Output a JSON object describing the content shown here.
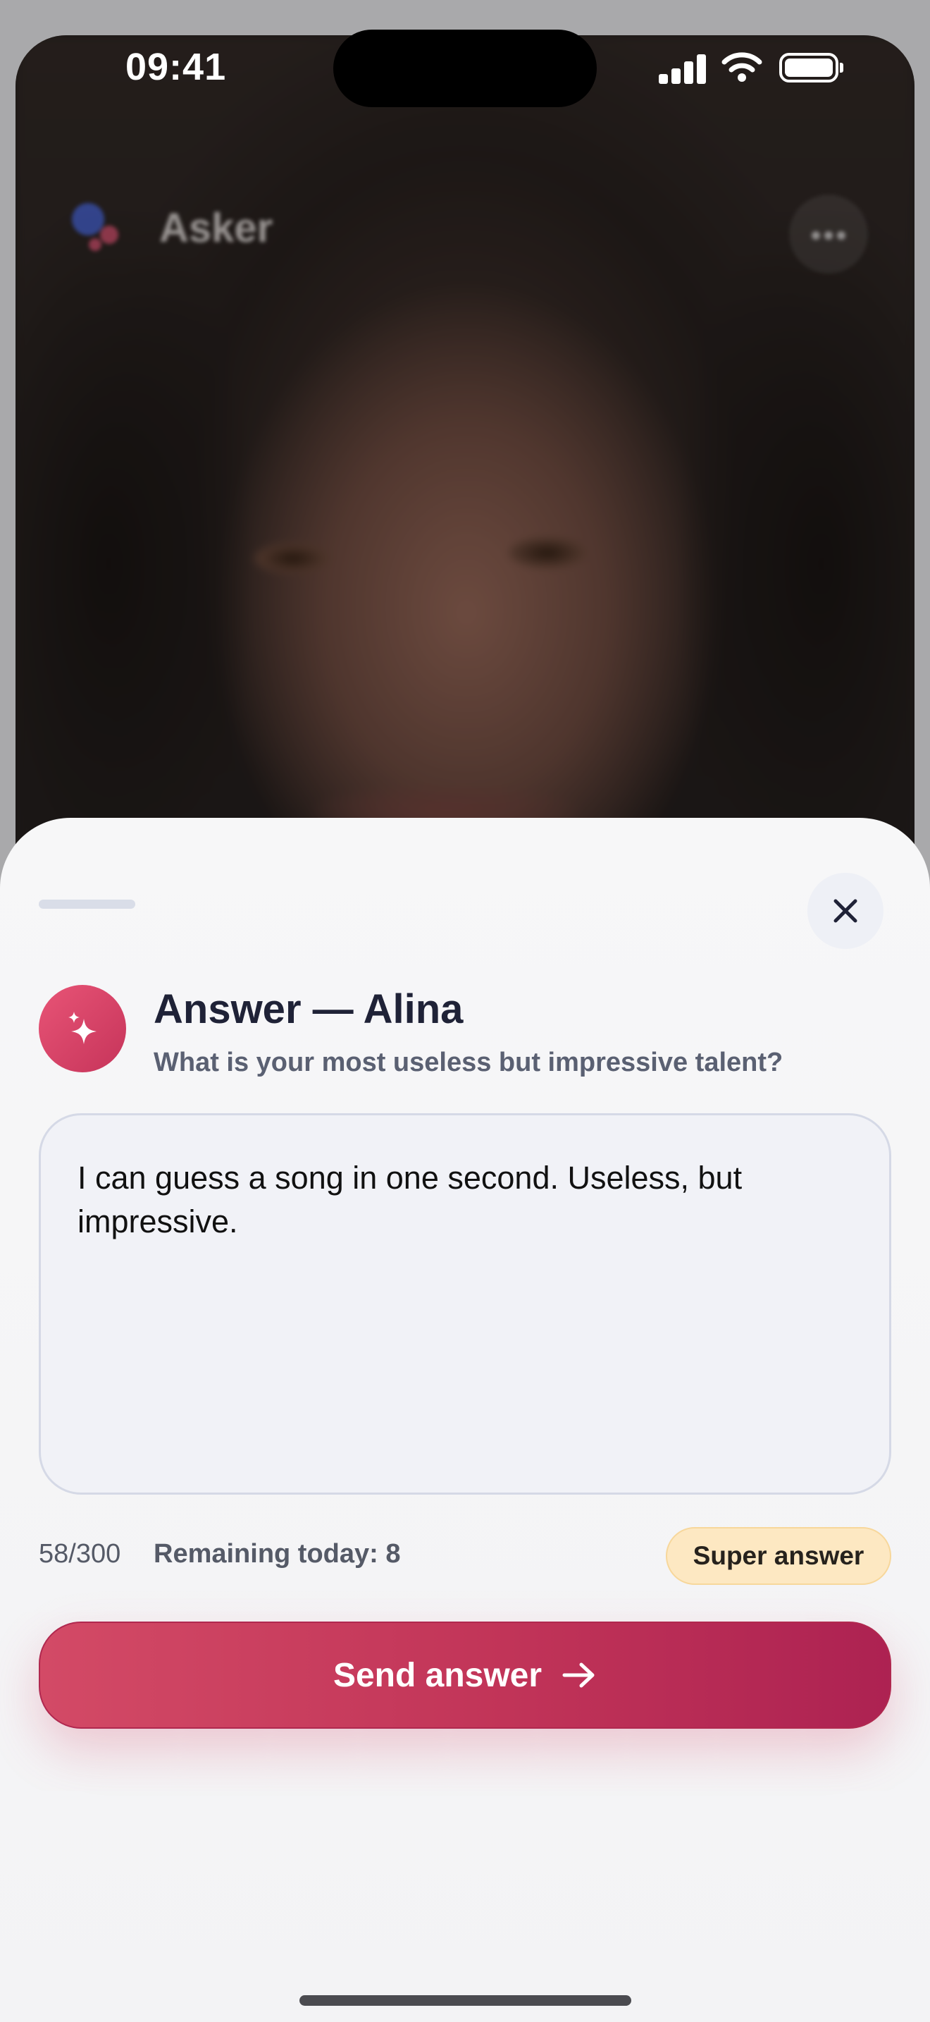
{
  "status_bar": {
    "time": "09:41"
  },
  "app": {
    "brand": "Asker"
  },
  "sheet": {
    "title": "Answer — Alina",
    "question": "What is your most useless but impressive talent?",
    "answer_text": "I can guess a song in one second. Useless, but impressive.",
    "char_counter": "58/300",
    "remaining": "Remaining today: 8",
    "super_answer_label": "Super answer",
    "send_label": "Send answer",
    "icons": {
      "close": "close-icon",
      "avatar": "sparkle-icon",
      "send": "arrow-right-icon"
    }
  },
  "colors": {
    "accent": "#c6345a",
    "badge_bg": "#fde8c2",
    "title": "#1f2237"
  }
}
